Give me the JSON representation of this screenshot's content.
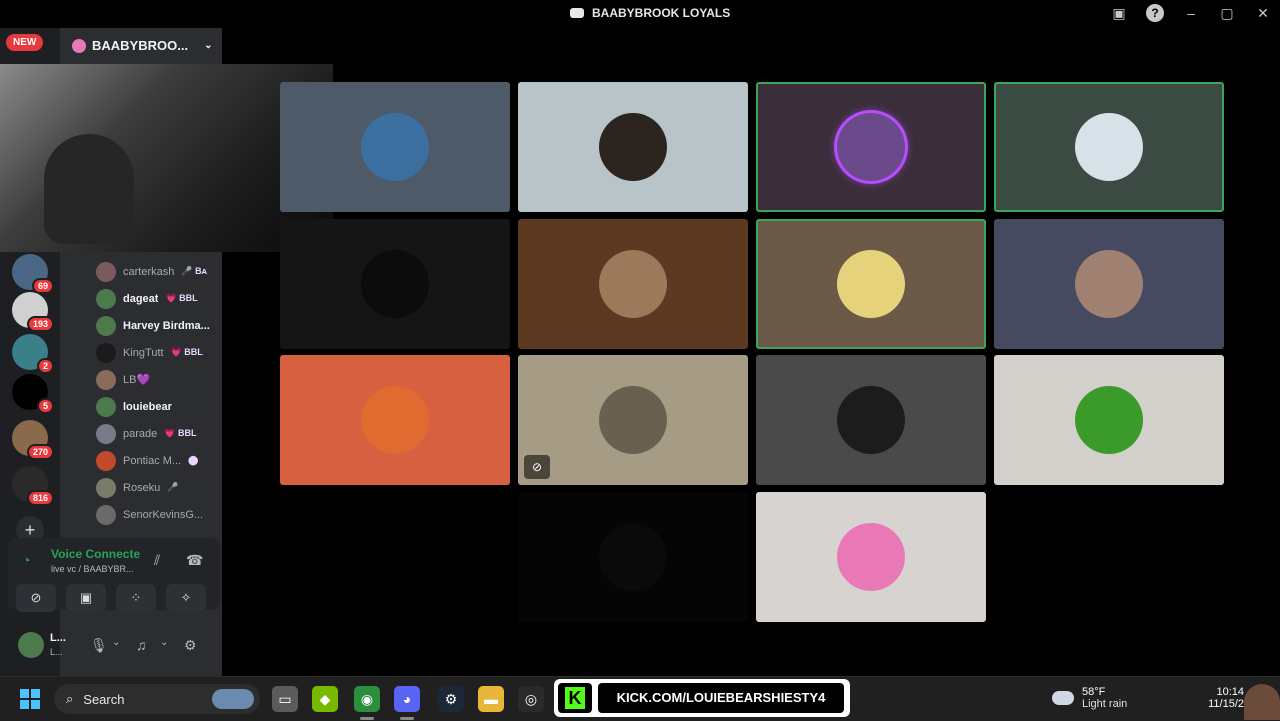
{
  "window": {
    "title": "BAABYBROOK LOYALS",
    "icons": [
      "inbox-icon",
      "help-icon",
      "minimize-icon",
      "maximize-icon",
      "close-icon"
    ]
  },
  "server_rail": {
    "new_label": "NEW",
    "servers": [
      {
        "badge": "69",
        "color": "#4a6785"
      },
      {
        "badge": "193",
        "color": "#d0d0d0"
      },
      {
        "badge": "2",
        "color": "#3a7f8a"
      },
      {
        "badge": "5",
        "color": "#000000"
      },
      {
        "badge": "270",
        "color": "#8a6a4a"
      },
      {
        "badge": "816",
        "color": "#2a2a2a"
      }
    ]
  },
  "server_header": {
    "name": "BAABYBROO..."
  },
  "members": [
    {
      "name": "carterkash",
      "tag": "🎤 Bᴀ",
      "bold": false,
      "color": "#7a5a5a"
    },
    {
      "name": "dageat",
      "tag": "💗 BBL",
      "bold": true,
      "color": "#4d7a4d"
    },
    {
      "name": "Harvey Birdma...",
      "tag": "",
      "bold": true,
      "color": "#4d7a4d"
    },
    {
      "name": "KingTutt",
      "tag": "💗 BBL",
      "bold": false,
      "color": "#1a1a1a"
    },
    {
      "name": "LB💜",
      "tag": "",
      "bold": false,
      "color": "#8a6a5a"
    },
    {
      "name": "louiebear",
      "tag": "",
      "bold": true,
      "color": "#4d7a4d"
    },
    {
      "name": "parade",
      "tag": "💗 BBL",
      "bold": false,
      "color": "#7a7a8a"
    },
    {
      "name": "Pontiac M...",
      "tag": "⬤",
      "bold": false,
      "color": "#c04a2a"
    },
    {
      "name": "Roseku",
      "tag": "🎤",
      "bold": false,
      "color": "#7a7a6a"
    },
    {
      "name": "SenorKevinsG...",
      "tag": "",
      "bold": false,
      "color": "#6a6a6a"
    }
  ],
  "voice": {
    "status": "Voice Connecte",
    "channel": "live vc / BAABYBR..."
  },
  "user": {
    "name": "L...",
    "status": "L..."
  },
  "tiles": [
    {
      "bg": "#4e5a68",
      "avatar": "#3a6fa0",
      "speaking": false,
      "muted": false
    },
    {
      "bg": "#b8c4c7",
      "avatar": "#2b241f",
      "speaking": false,
      "muted": false
    },
    {
      "bg": "#3a2e3a",
      "avatar": "#6a4a8a",
      "speaking": true,
      "muted": false
    },
    {
      "bg": "#3b4a42",
      "avatar": "#d8e0e8",
      "speaking": true,
      "muted": false
    },
    {
      "bg": "#151515",
      "avatar": "#0c0c0c",
      "speaking": false,
      "muted": false
    },
    {
      "bg": "#5c3a22",
      "avatar": "#9a7a5a",
      "speaking": false,
      "muted": false
    },
    {
      "bg": "#6b5a48",
      "avatar": "#e6d27a",
      "speaking": true,
      "muted": false
    },
    {
      "bg": "#454a60",
      "avatar": "#a08070",
      "speaking": false,
      "muted": false
    },
    {
      "bg": "#d6603f",
      "avatar": "#e06a30",
      "speaking": false,
      "muted": false
    },
    {
      "bg": "#a69c86",
      "avatar": "#6a6050",
      "speaking": false,
      "muted": true
    },
    {
      "bg": "#4a4a4a",
      "avatar": "#1c1c1c",
      "speaking": false,
      "muted": false
    },
    {
      "bg": "#d3d0cc",
      "avatar": "#3a9a2a",
      "speaking": false,
      "muted": false
    },
    {
      "bg": "#050505",
      "avatar": "#0a0a0a",
      "speaking": false,
      "muted": false
    },
    {
      "bg": "#d6d3d0",
      "avatar": "#e879b6",
      "speaking": false,
      "muted": false
    }
  ],
  "taskbar": {
    "search_label": "Search",
    "apps": [
      {
        "name": "file-explorer-icon",
        "color": "#5b5b5b",
        "glyph": "▭"
      },
      {
        "name": "nvidia-icon",
        "color": "#76b900",
        "glyph": "◆"
      },
      {
        "name": "chrome-icon",
        "color": "#2b8f3e",
        "glyph": "◉"
      },
      {
        "name": "discord-icon",
        "color": "#5865f2",
        "glyph": "◕"
      },
      {
        "name": "steam-icon",
        "color": "#1b2838",
        "glyph": "⚙"
      },
      {
        "name": "folder-icon",
        "color": "#e8b739",
        "glyph": "▬"
      },
      {
        "name": "obs-icon",
        "color": "#2a2a2a",
        "glyph": "◎"
      }
    ]
  },
  "kick": {
    "url": "KICK.COM/LOUIEBEARSHIESTY4"
  },
  "weather": {
    "temp": "58°F",
    "desc": "Light rain"
  },
  "clock": {
    "time": "10:14",
    "date": "11/15/2"
  }
}
